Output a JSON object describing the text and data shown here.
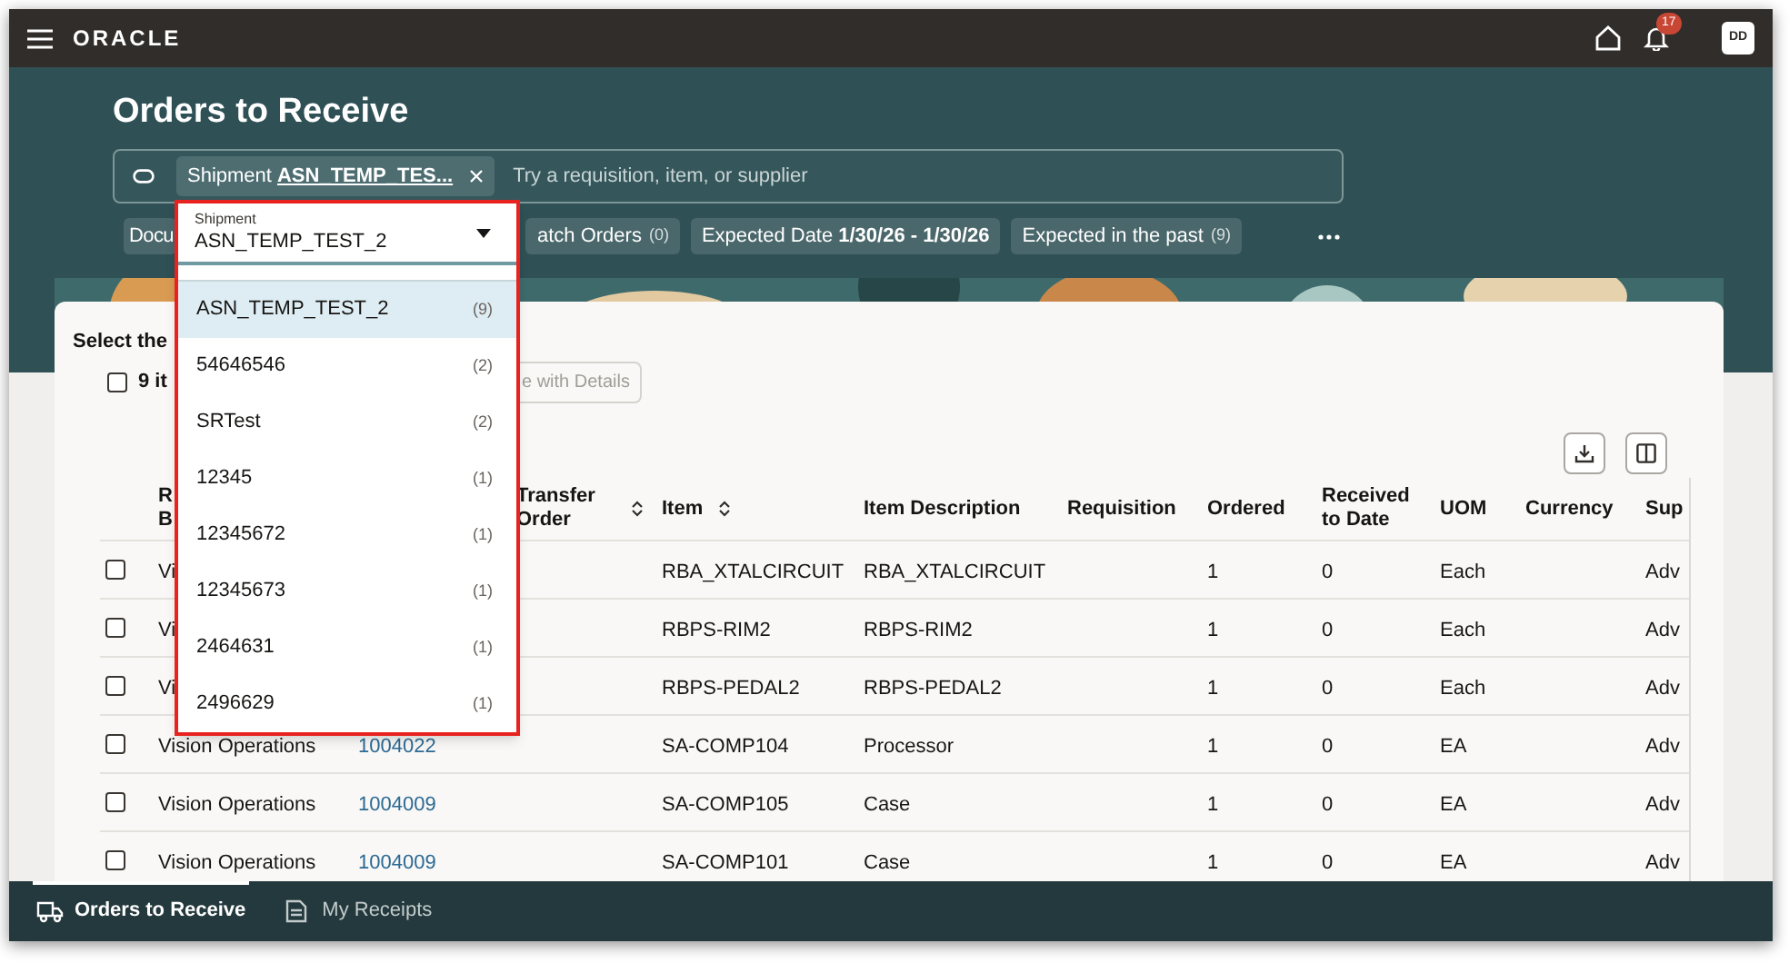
{
  "topbar": {
    "brand": "ORACLE",
    "notification_count": "17",
    "avatar": "DD"
  },
  "page_title": "Orders to Receive",
  "search": {
    "chip_label": "Shipment",
    "chip_value": "ASN_TEMP_TES...",
    "placeholder": "Try a requisition, item, or supplier"
  },
  "filters": [
    {
      "label": "Docu"
    },
    {
      "label": "atch Orders",
      "count": "(0)"
    },
    {
      "label": "Expected Date",
      "value": "1/30/26 - 1/30/26"
    },
    {
      "label": "Expected in the past",
      "count": "(9)"
    }
  ],
  "card": {
    "heading": "Select the",
    "selection": {
      "label": "9 it",
      "checked": false
    },
    "action_button": "e with Details"
  },
  "table": {
    "columns": [
      {
        "label": "R B"
      },
      {},
      {
        "label": "Transfer Order",
        "sortable": true
      },
      {
        "label": "Item",
        "sortable": true
      },
      {
        "label": "Item Description",
        "sortable": false
      },
      {
        "label": "Requisition",
        "sortable": false
      },
      {
        "label": "Ordered",
        "sortable": false
      },
      {
        "label": "Received to Date",
        "sortable": false
      },
      {
        "label": "UOM",
        "sortable": false
      },
      {
        "label": "Currency",
        "sortable": false
      },
      {
        "label": "Sup"
      }
    ],
    "rows": [
      {
        "checked": false,
        "cells": [
          "Vi",
          null,
          null,
          "RBA_XTALCIRCUIT",
          "RBA_XTALCIRCUIT",
          null,
          "1",
          "0",
          "Each",
          null,
          "Adv"
        ]
      },
      {
        "checked": false,
        "cells": [
          "Vi",
          null,
          null,
          "RBPS-RIM2",
          "RBPS-RIM2",
          null,
          "1",
          "0",
          "Each",
          null,
          "Adv"
        ]
      },
      {
        "checked": false,
        "cells": [
          "Vi",
          null,
          null,
          "RBPS-PEDAL2",
          "RBPS-PEDAL2",
          null,
          "1",
          "0",
          "Each",
          null,
          "Adv"
        ]
      },
      {
        "checked": false,
        "cells": [
          "Vision Operations",
          "1004022",
          null,
          "SA-COMP104",
          "Processor",
          null,
          "1",
          "0",
          "EA",
          null,
          "Adv"
        ]
      },
      {
        "checked": false,
        "cells": [
          "Vision Operations",
          "1004009",
          null,
          "SA-COMP105",
          "Case",
          null,
          "1",
          "0",
          "EA",
          null,
          "Adv"
        ]
      },
      {
        "checked": false,
        "cells": [
          "Vision Operations",
          "1004009",
          null,
          "SA-COMP101",
          "Case",
          null,
          "1",
          "0",
          "EA",
          null,
          "Adv"
        ]
      }
    ]
  },
  "dropdown": {
    "label": "Shipment",
    "value": "ASN_TEMP_TEST_2",
    "options": [
      {
        "label": "ASN_TEMP_TEST_2",
        "count": "(9)",
        "selected": true
      },
      {
        "label": "54646546",
        "count": "(2)",
        "selected": false
      },
      {
        "label": "SRTest",
        "count": "(2)",
        "selected": false
      },
      {
        "label": "12345",
        "count": "(1)",
        "selected": false
      },
      {
        "label": "12345672",
        "count": "(1)",
        "selected": false
      },
      {
        "label": "12345673",
        "count": "(1)",
        "selected": false
      },
      {
        "label": "2464631",
        "count": "(1)",
        "selected": false
      },
      {
        "label": "2496629",
        "count": "(1)",
        "selected": false
      }
    ]
  },
  "bottom_nav": [
    {
      "kind": "truck",
      "label": "Orders to Receive",
      "selected": true
    },
    {
      "kind": "receipt",
      "label": "My Receipts",
      "selected": false
    }
  ]
}
